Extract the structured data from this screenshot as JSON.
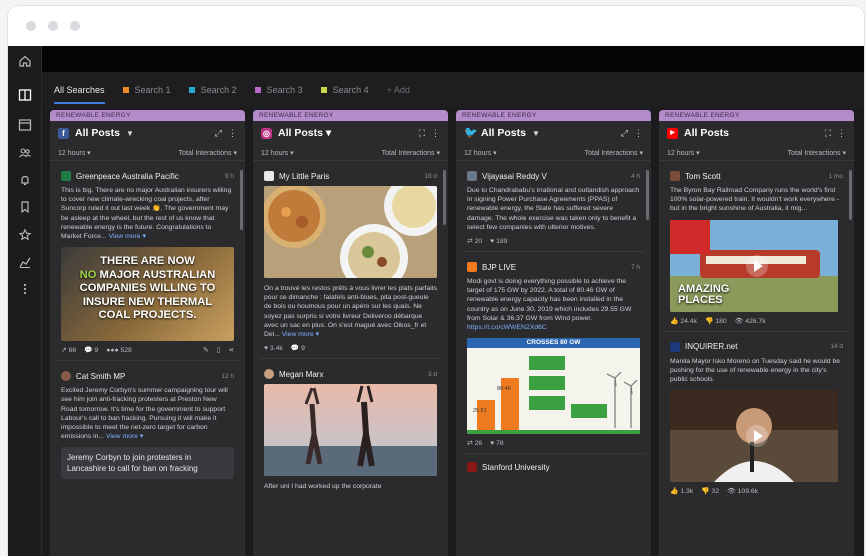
{
  "tabs": [
    {
      "label": "All Searches",
      "color": ""
    },
    {
      "label": "Search 1",
      "color": "#f08a24"
    },
    {
      "label": "Search 2",
      "color": "#2aa9c9"
    },
    {
      "label": "Search 3",
      "color": "#b46ac9"
    },
    {
      "label": "Search 4",
      "color": "#c9d84a"
    },
    {
      "label": "+ Add",
      "color": ""
    }
  ],
  "rail_icons": [
    "home-icon",
    "columns-icon",
    "window-icon",
    "people-icon",
    "bell-icon",
    "bookmark-icon",
    "star-icon",
    "chart-icon",
    "more-icon"
  ],
  "columns": [
    {
      "band": "RENEWABLE ENERGY",
      "network": "facebook",
      "net_glyph": "f",
      "net_color": "#3b5998",
      "title": "All Posts",
      "time_filter": "12 hours ▾",
      "sort": "Total Interactions ▾",
      "posts": [
        {
          "author": "Greenpeace Australia Pacific",
          "time": "9 h",
          "text": "This is big. There are no major Australian insurers willing to cover new climate-wrecking coal projects, after Suncorp ruled it out last week 👏. The government may be asleep at the wheel, but the rest of us know that renewable energy is the future. Congratulations to Market Force...",
          "more": "View more ▾",
          "image_lines": [
            "THERE ARE NOW",
            "NO MAJOR AUSTRALIAN",
            "COMPANIES WILLING TO",
            "INSURE NEW THERMAL",
            "COAL PROJECTS."
          ],
          "metrics": [
            "↗ 66",
            "💬 9",
            "●●● 528"
          ]
        },
        {
          "author": "Cat Smith MP",
          "time": "12 h",
          "text": "Excited Jeremy Corbyn's summer campaigning tour will see him join anti-fracking protesters at Preston New Road tomorrow. It's time for the government to support Labour's call to ban fracking. Pursuing it will make it impossible to meet the net-zero target for carbon emissions in...",
          "more": "View more ▾",
          "quote": "Jeremy Corbyn to join protesters in Lancashire to call for ban on fracking"
        }
      ]
    },
    {
      "band": "RENEWABLE ENERGY",
      "network": "instagram",
      "net_glyph": "◎",
      "net_color": "#c13584",
      "title": "All Posts ▾",
      "time_filter": "12 hours ▾",
      "sort": "Total Interactions ▾",
      "posts": [
        {
          "author": "My Little Paris",
          "time": "18 d",
          "text": "On a trouvé les restos prêts à vous livrer les plats parfaits pour ce dimanche : falafels anti-blues, pita post-gueule de bois ou houmous pour un apéro sur les quais. Ne soyez pas surpris si votre livreur Deliveroo débarque avec un sac en plus. On s'est magué avec Oikos_fr et Del...",
          "more": "View more ▾",
          "metrics": [
            "♥ 3.4k",
            "💬 9"
          ]
        },
        {
          "author": "Megan Marx",
          "time": "3 d",
          "text": "After uni I had worked up the corporate"
        }
      ]
    },
    {
      "band": "RENEWABLE ENERGY",
      "network": "twitter",
      "net_glyph": "t",
      "net_color": "#1da1f2",
      "title": "All Posts",
      "time_filter": "12 hours ▾",
      "sort": "Total Interactions ▾",
      "posts": [
        {
          "author": "Vijayasai Reddy V",
          "time": "4 h",
          "text": "Due to Chandrababu's irrational and outlandish approach in signing Power Purchase Agreements (PPAS) of renewable energy, the State has suffered severe damage. The whole exercise was taken only to benefit a select few companies with ulterior motives.",
          "metrics": [
            "⇄ 20",
            "♥ 189"
          ]
        },
        {
          "author": "BJP LIVE",
          "time": "7 h",
          "text": "Modi govt is doing everything possible to achieve the target of 175 GW by 2022. A total of 80.46 GW of renewable energy capacity has been installed in the country as on June 30, 2019 which includes 29.55 GW from Solar & 36.37 GW from Wind power.",
          "link": "https://t.co/cWWEN2Xd6C",
          "chart_heading": "CROSSES 80 GW",
          "bars": [
            {
              "label": "",
              "value": "25.51"
            },
            {
              "label": "",
              "value": "80.46"
            }
          ],
          "metrics": [
            "⇄ 26",
            "♥ 78"
          ]
        },
        {
          "author": "Stanford University",
          "time": ""
        }
      ]
    },
    {
      "band": "RENEWABLE ENERGY",
      "network": "youtube",
      "net_glyph": "▶",
      "net_color": "#ff0000",
      "title": "All Posts",
      "time_filter": "12 hours ▾",
      "sort": "Total Interactions ▾",
      "posts": [
        {
          "author": "Tom Scott",
          "time": "1 mo",
          "text": "The Byron Bay Railroad Company runs the world's first 100% solar-powered train. It wouldn't work everywhere - but in the bright sunshine of Australia, it mig...",
          "image_lines": [
            "AMAZING",
            "PLACES"
          ],
          "metrics": [
            "👍 24.4k",
            "👎 180",
            "👁 426.7k"
          ]
        },
        {
          "author": "INQUIRER.net",
          "time": "14 d",
          "text": "Manila Mayor Isko Moreno on Tuesday said he would be pushing for the use of renewable energy in the city's public schools.",
          "metrics": [
            "👍 1.3k",
            "👎 32",
            "👁 109.6k"
          ]
        }
      ]
    }
  ]
}
